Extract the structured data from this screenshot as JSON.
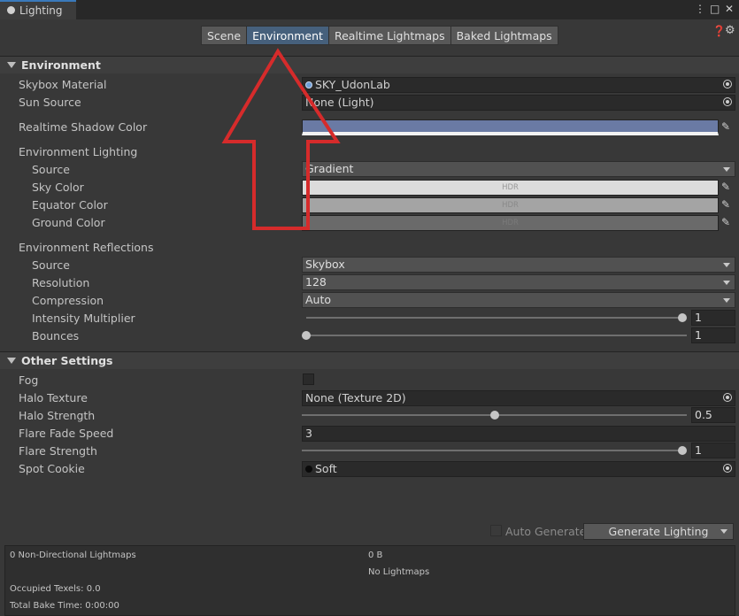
{
  "window": {
    "tab_title": "Lighting",
    "icon": "lightbulb-icon",
    "controls": [
      "kebab-menu-icon",
      "maximize-icon",
      "close-icon"
    ]
  },
  "toolbar": {
    "tabs": [
      "Scene",
      "Environment",
      "Realtime Lightmaps",
      "Baked Lightmaps"
    ],
    "active_tab": "Environment"
  },
  "environment": {
    "header": "Environment",
    "skybox_material": {
      "label": "Skybox Material",
      "value": "SKY_UdonLab"
    },
    "sun_source": {
      "label": "Sun Source",
      "value": "None (Light)"
    },
    "realtime_shadow_color": {
      "label": "Realtime Shadow Color",
      "color": "#6a7aa4"
    },
    "lighting": {
      "label": "Environment Lighting",
      "source": {
        "label": "Source",
        "value": "Gradient"
      },
      "sky_color": {
        "label": "Sky Color",
        "badge": "HDR",
        "color": "#dcdcdc"
      },
      "equator_color": {
        "label": "Equator Color",
        "badge": "HDR",
        "color": "#a4a4a4"
      },
      "ground_color": {
        "label": "Ground Color",
        "badge": "HDR",
        "color": "#6a6a6a"
      }
    },
    "reflections": {
      "label": "Environment Reflections",
      "source": {
        "label": "Source",
        "value": "Skybox"
      },
      "resolution": {
        "label": "Resolution",
        "value": "128"
      },
      "compression": {
        "label": "Compression",
        "value": "Auto"
      },
      "intensity_multiplier": {
        "label": "Intensity Multiplier",
        "value": "1",
        "level": 1.0
      },
      "bounces": {
        "label": "Bounces",
        "value": "1",
        "level": 0.0
      }
    }
  },
  "other_settings": {
    "header": "Other Settings",
    "fog": {
      "label": "Fog",
      "checked": false
    },
    "halo_texture": {
      "label": "Halo Texture",
      "value": "None (Texture 2D)"
    },
    "halo_strength": {
      "label": "Halo Strength",
      "value": "0.5",
      "level": 0.5
    },
    "flare_fade_speed": {
      "label": "Flare Fade Speed",
      "value": "3"
    },
    "flare_strength": {
      "label": "Flare Strength",
      "value": "1",
      "level": 1.0
    },
    "spot_cookie": {
      "label": "Spot Cookie",
      "value": "Soft"
    }
  },
  "generate": {
    "auto_generate_label": "Auto Generate",
    "auto_generate_checked": false,
    "button_label": "Generate Lighting"
  },
  "stats": {
    "lightmaps": "0 Non-Directional Lightmaps",
    "size": "0 B",
    "no_lightmaps": "No Lightmaps",
    "occupied_texels": "Occupied Texels: 0.0",
    "total_bake_time": "Total Bake Time: 0:00:00"
  },
  "overlay": {
    "arrow_color": "#d62b2b"
  }
}
